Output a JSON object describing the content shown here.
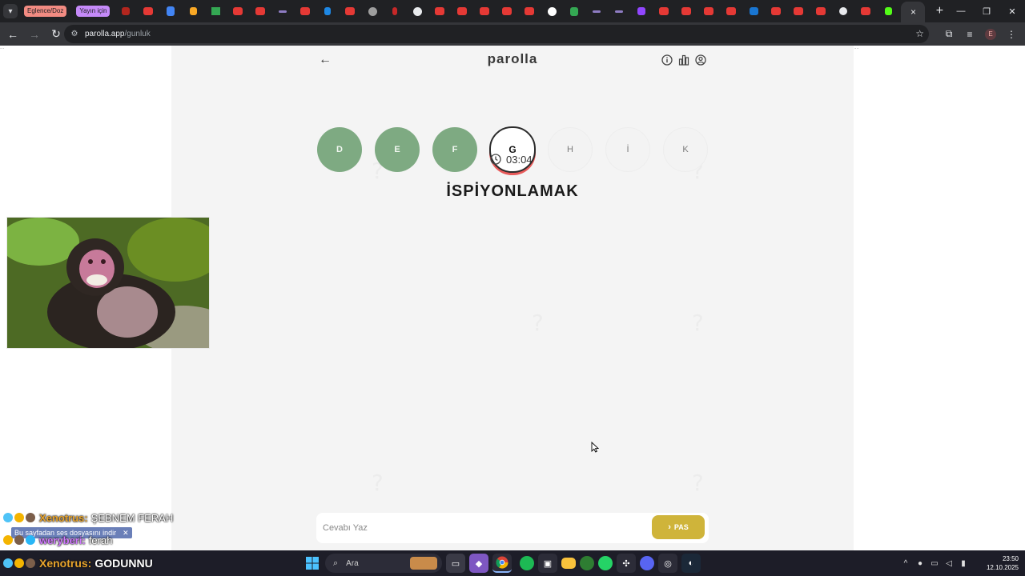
{
  "browser": {
    "tab_groups": [
      "Eglence/Doz",
      "Yayın için"
    ],
    "active_tab_close": "×",
    "new_tab": "+",
    "address": {
      "host": "parolla.app",
      "path": "/gunluk"
    },
    "profile_initial": "E"
  },
  "game": {
    "logo": "parolla",
    "letters": [
      {
        "char": "D",
        "state": "done"
      },
      {
        "char": "E",
        "state": "done"
      },
      {
        "char": "F",
        "state": "done"
      },
      {
        "char": "G",
        "state": "current"
      },
      {
        "char": "H",
        "state": "pending"
      },
      {
        "char": "İ",
        "state": "pending"
      },
      {
        "char": "K",
        "state": "pending"
      }
    ],
    "timer": "03:04",
    "word": "İSPİYONLAMAK",
    "answer_placeholder": "Cevabı Yaz",
    "pass_label": "PAS"
  },
  "chat": {
    "line1": {
      "user": "Xenotrus:",
      "message": "ŞEBNEM FERAH"
    },
    "notice": "Bu sayfadan ses dosyasını indir",
    "line2": {
      "user": "weryberi:",
      "message": "ferah"
    },
    "line3": {
      "user": "Xenotrus:",
      "message": "GODUNNU"
    }
  },
  "taskbar": {
    "search_label": "Ara",
    "time": "23:50",
    "date": "12.10.2025"
  },
  "colors": {
    "done_letter": "#7eaa82",
    "current_ring": "#e85a5a",
    "pass_button": "#cfb43a",
    "tab_group_red": "#f28b82",
    "tab_group_purple": "#c58af9"
  },
  "icons": {
    "header": [
      "info-icon",
      "stats-icon",
      "user-icon"
    ],
    "timer": "clock-icon"
  }
}
